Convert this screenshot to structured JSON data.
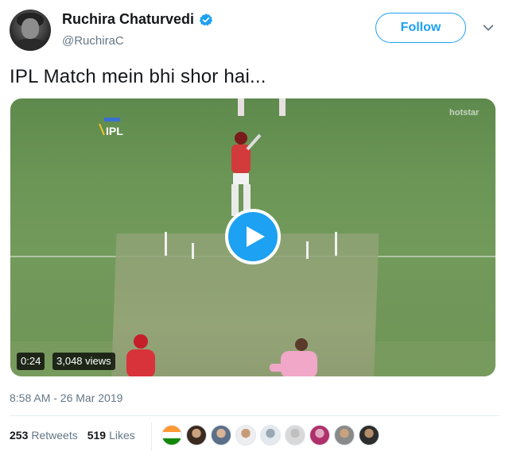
{
  "user": {
    "display_name": "Ruchira Chaturvedi",
    "handle": "@RuchiraC",
    "verified": true
  },
  "follow_label": "Follow",
  "tweet_text": "IPL Match mein bhi shor hai...",
  "video": {
    "logo_text": "IPL",
    "broadcaster_text": "hotstar",
    "duration": "0:24",
    "views": "3,048 views"
  },
  "timestamp": "8:58 AM - 26 Mar 2019",
  "stats": {
    "retweets_count": "253",
    "retweets_label": "Retweets",
    "likes_count": "519",
    "likes_label": "Likes"
  },
  "likers": [
    {
      "icon": "flag-avatar"
    },
    {
      "icon": "user-avatar"
    },
    {
      "icon": "user-avatar"
    },
    {
      "icon": "user-avatar"
    },
    {
      "icon": "user-avatar"
    },
    {
      "icon": "user-avatar"
    },
    {
      "icon": "user-avatar"
    },
    {
      "icon": "user-avatar"
    },
    {
      "icon": "user-avatar"
    }
  ],
  "colors": {
    "accent": "#1da1f2",
    "secondary_text": "#657786",
    "primary_text": "#14171a"
  }
}
